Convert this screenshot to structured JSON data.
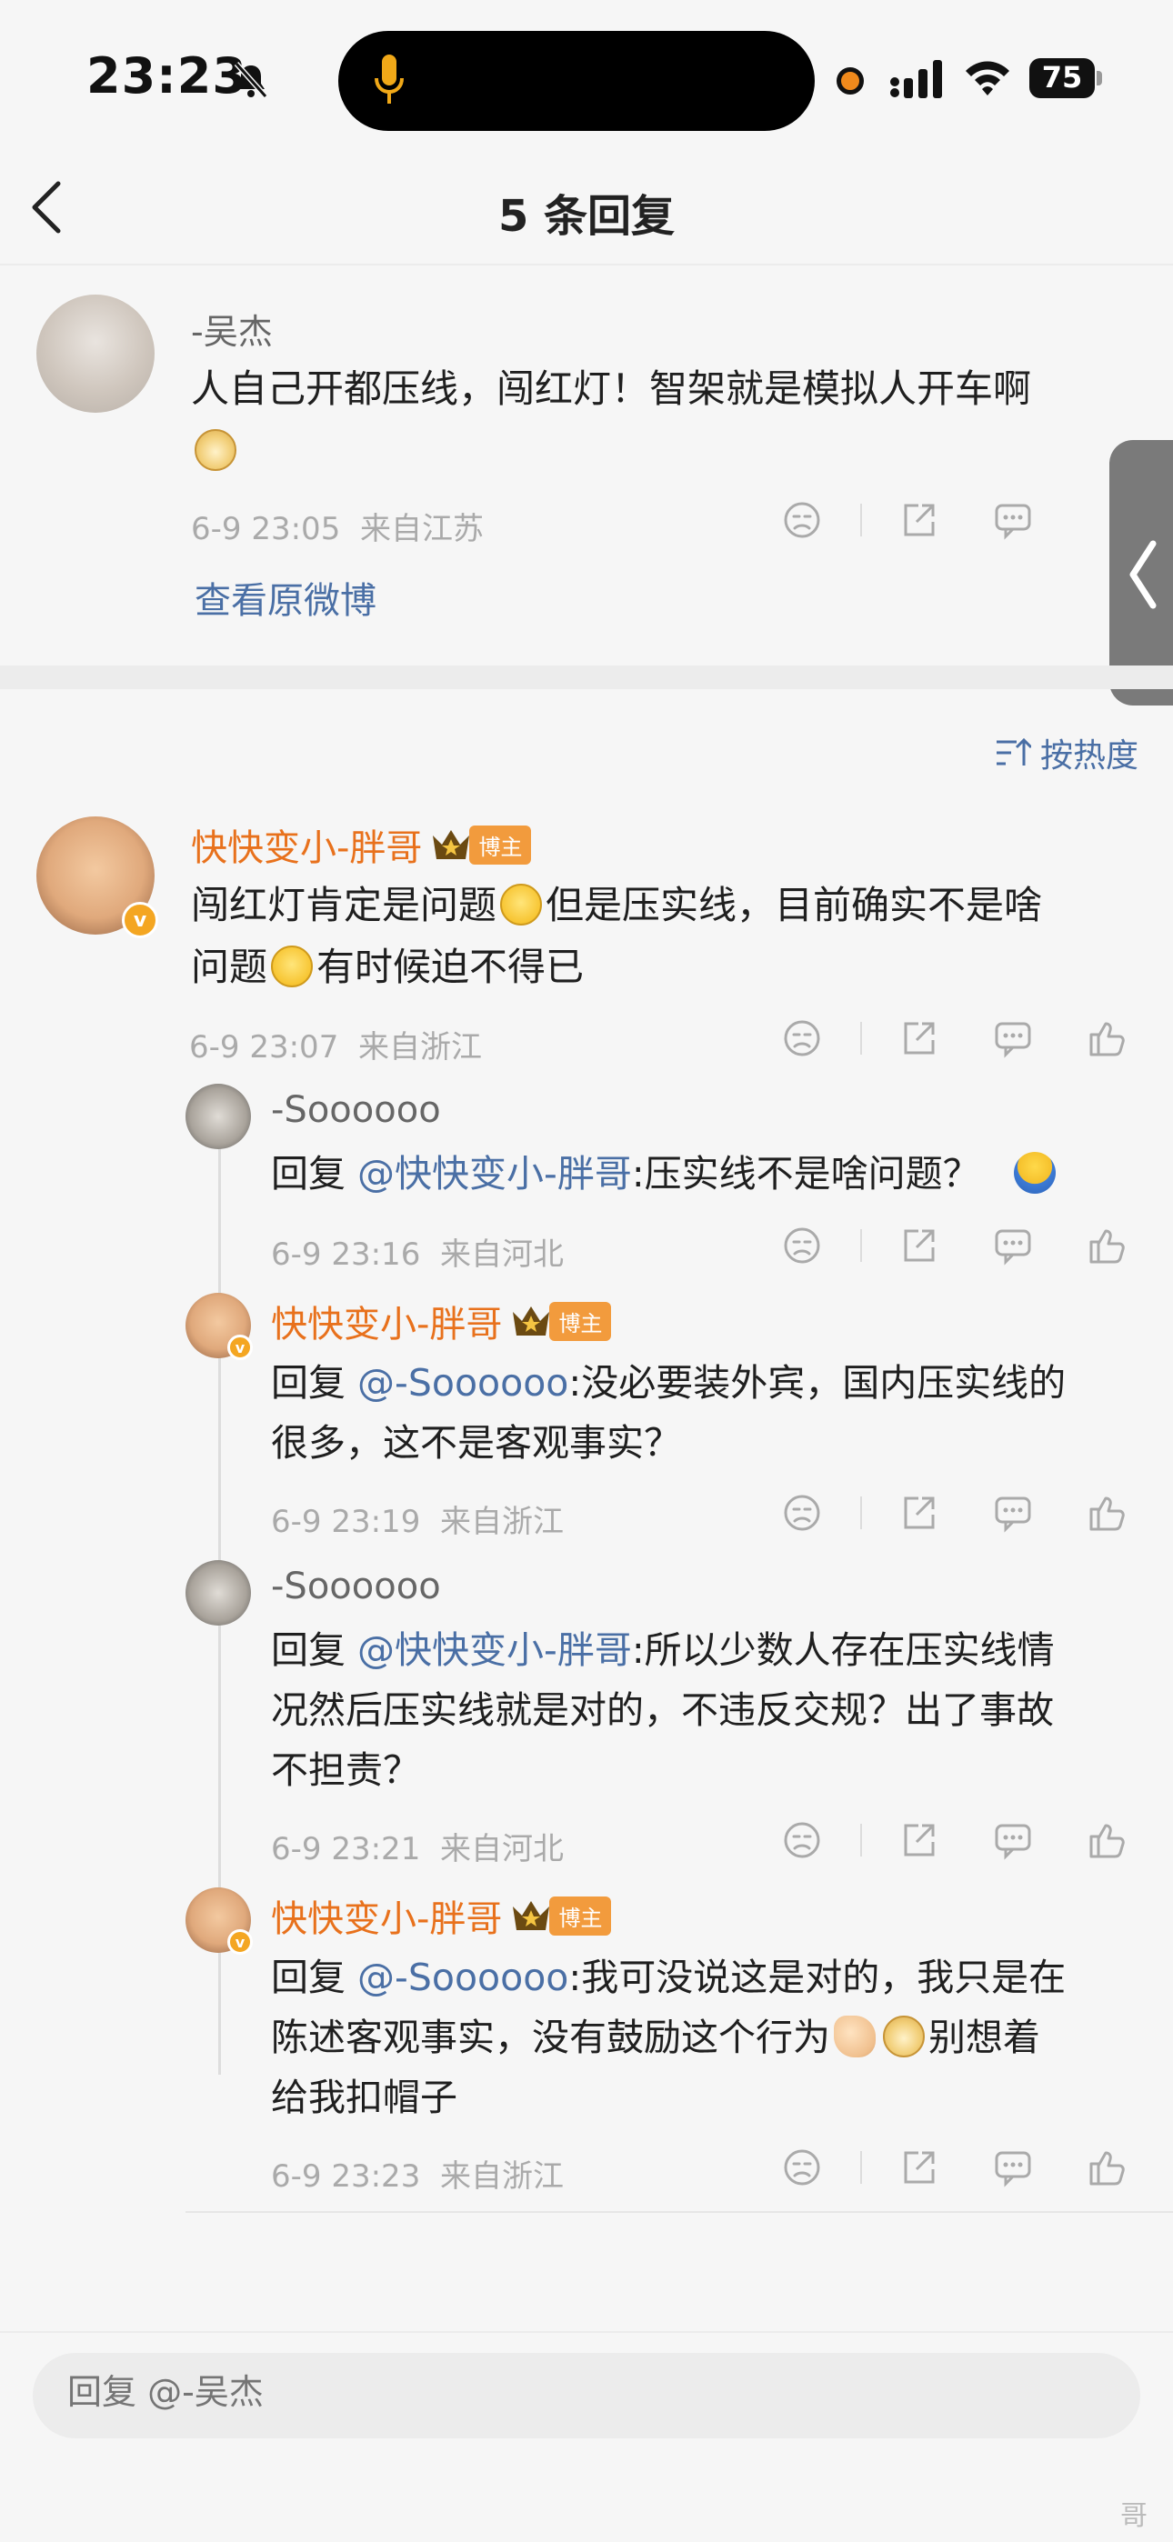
{
  "status_bar": {
    "time": "23:23",
    "battery": "75"
  },
  "header": {
    "title": "5 条回复"
  },
  "original_comment": {
    "username": "-吴杰",
    "text": "人自己开都压线，闯红灯！智架就是模拟人开车啊",
    "time": "6-9 23:05",
    "location": "来自江苏",
    "view_original": "查看原微博"
  },
  "sort": {
    "label": "按热度"
  },
  "comments": [
    {
      "username": "快快变小-胖哥",
      "badge": "博主",
      "text_part1": "闯红灯肯定是问题",
      "text_part2": "但是压实线，目前确实不是啥",
      "text_part3": "问题",
      "text_part4": "有时候迫不得已",
      "time": "6-9 23:07",
      "location": "来自浙江"
    }
  ],
  "replies": [
    {
      "username": "-Soooooo",
      "reply_prefix": "回复",
      "mention": "@快快变小-胖哥",
      "text_line1": ":压实线不是啥问题？",
      "time": "6-9 23:16",
      "location": "来自河北"
    },
    {
      "username": "快快变小-胖哥",
      "badge": "博主",
      "reply_prefix": "回复",
      "mention": "@-Soooooo",
      "text_line1": ":没必要装外宾，国内压实线的",
      "text_line2": "很多，这不是客观事实？",
      "time": "6-9 23:19",
      "location": "来自浙江"
    },
    {
      "username": "-Soooooo",
      "reply_prefix": "回复",
      "mention": "@快快变小-胖哥",
      "text_line1": ":所以少数人存在压实线情",
      "text_line2": "况然后压实线就是对的，不违反交规？出了事故",
      "text_line3": "不担责？",
      "time": "6-9 23:21",
      "location": "来自河北"
    },
    {
      "username": "快快变小-胖哥",
      "badge": "博主",
      "reply_prefix": "回复",
      "mention": "@-Soooooo",
      "text_line1": ":我可没说这是对的，我只是在",
      "text_line2a": "陈述客观事实，没有鼓励这个行为",
      "text_line2b": "别想着",
      "text_line3": "给我扣帽子",
      "time": "6-9 23:23",
      "location": "来自浙江"
    }
  ],
  "bottom": {
    "placeholder": "回复 @-吴杰",
    "watermark": "哥"
  },
  "icons": {
    "dislike": "dislike-face-icon",
    "share": "share-icon",
    "comment": "comment-icon",
    "like": "thumbs-up-icon"
  },
  "colors": {
    "accent_orange": "#e8711c",
    "link_blue": "#4a6fa5",
    "badge": "#f29b3d"
  }
}
